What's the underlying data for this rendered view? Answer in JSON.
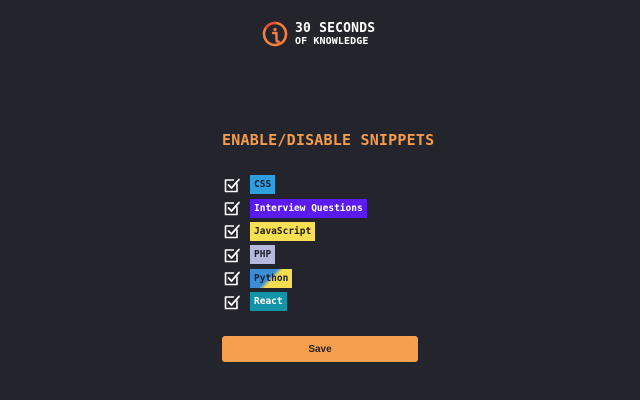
{
  "logo": {
    "line1": "30 SECONDS",
    "line2": "OF KNOWLEDGE",
    "icon": "30-seconds-logo-icon",
    "accent_color": "#f6803d"
  },
  "heading": "ENABLE/DISABLE SNIPPETS",
  "snippets": [
    {
      "label": "CSS",
      "checked": true,
      "color": "#2f9fe0"
    },
    {
      "label": "Interview Questions",
      "checked": true,
      "color": "#5b1bf0"
    },
    {
      "label": "JavaScript",
      "checked": true,
      "color": "#f6df52"
    },
    {
      "label": "PHP",
      "checked": true,
      "color": "#b5b9dc"
    },
    {
      "label": "Python",
      "checked": true,
      "color": "#3c8ed4"
    },
    {
      "label": "React",
      "checked": true,
      "color": "#1393a8"
    }
  ],
  "save_label": "Save",
  "colors": {
    "background": "#24242c",
    "heading": "#f39c4a",
    "button": "#f6a04d"
  }
}
